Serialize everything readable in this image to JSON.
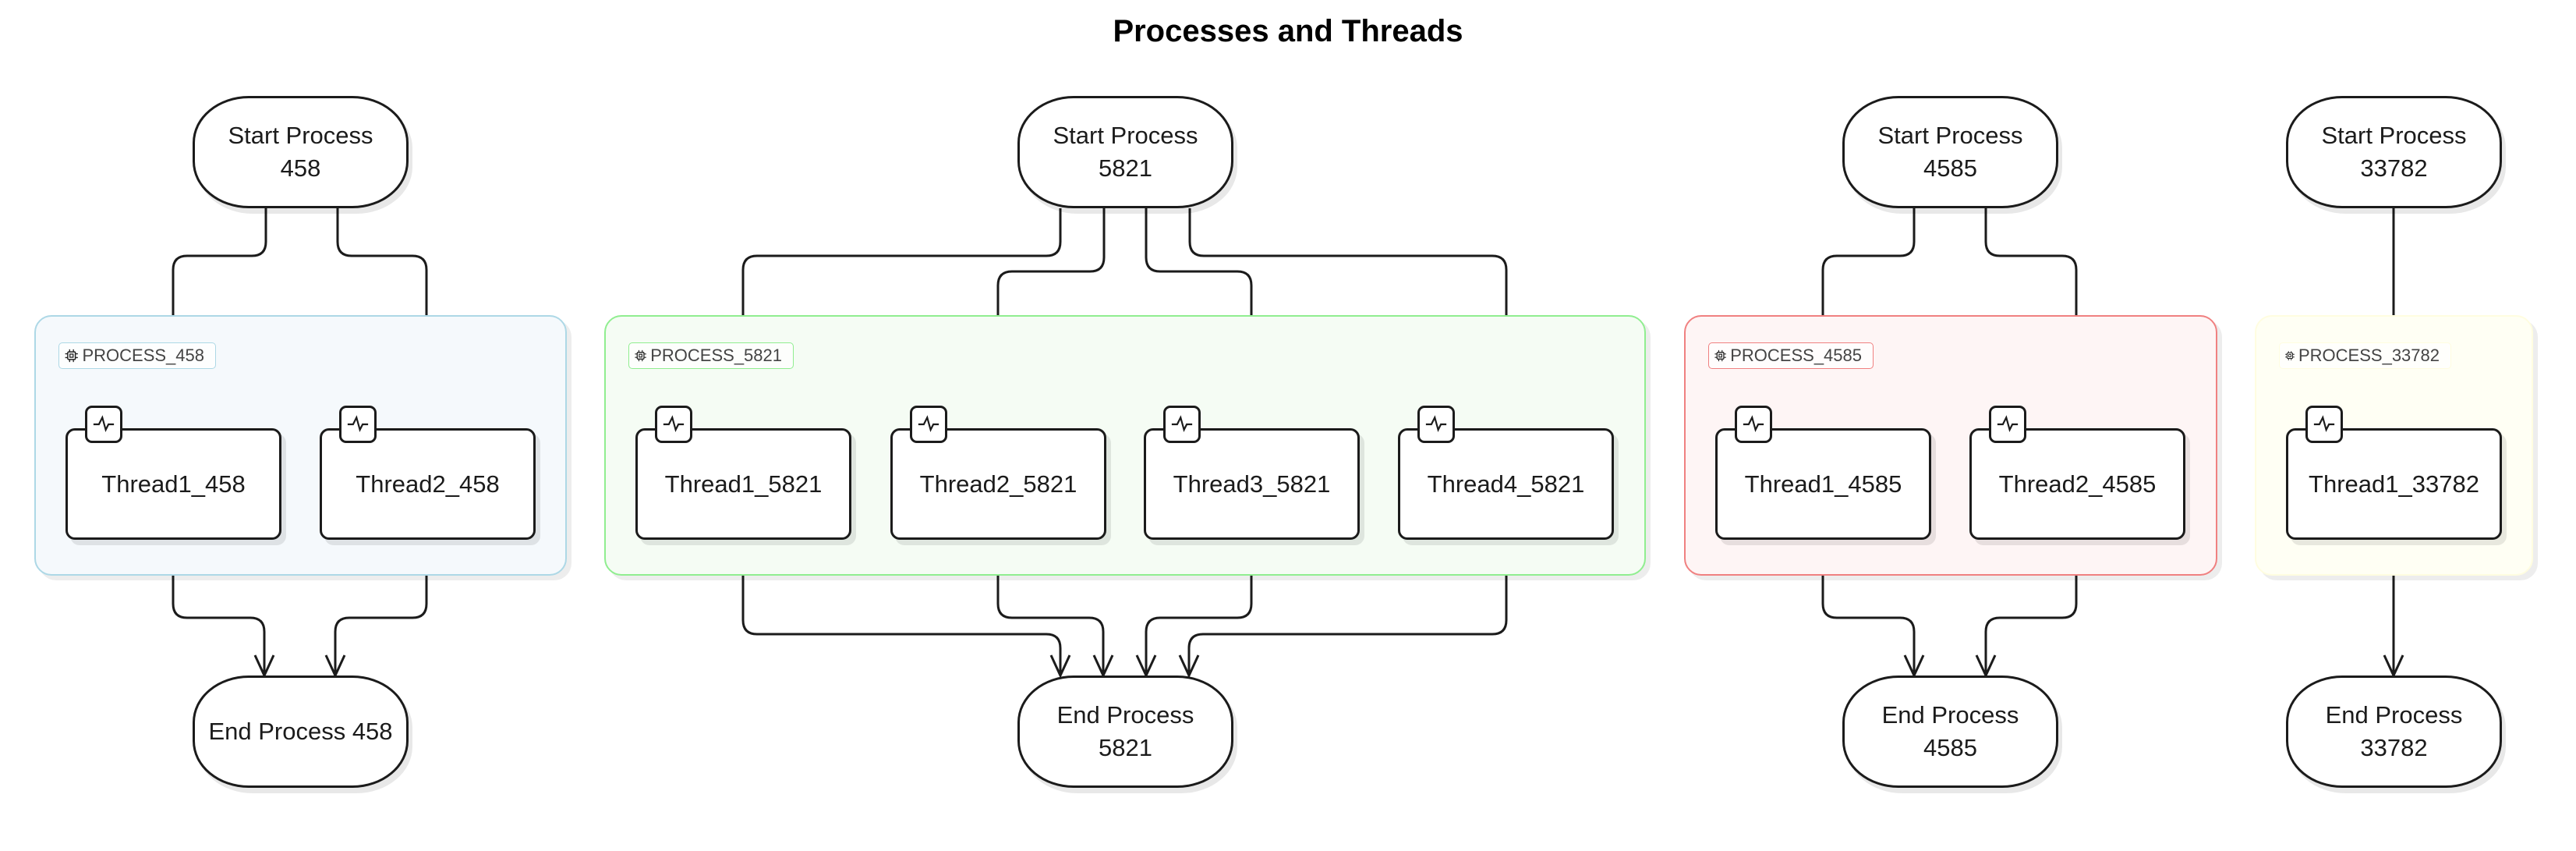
{
  "title": "Processes and Threads",
  "processes": [
    {
      "id": "458",
      "start_label": "Start Process\n458",
      "end_label": "End Process 458",
      "group_label": "PROCESS_458",
      "group_colors": {
        "border": "#add8e6",
        "fill": "#f5f9fc"
      },
      "threads": [
        "Thread1_458",
        "Thread2_458"
      ]
    },
    {
      "id": "5821",
      "start_label": "Start Process\n5821",
      "end_label": "End Process\n5821",
      "group_label": "PROCESS_5821",
      "group_colors": {
        "border": "#90ee90",
        "fill": "#f5fcf4"
      },
      "threads": [
        "Thread1_5821",
        "Thread2_5821",
        "Thread3_5821",
        "Thread4_5821"
      ]
    },
    {
      "id": "4585",
      "start_label": "Start Process\n4585",
      "end_label": "End Process\n4585",
      "group_label": "PROCESS_4585",
      "group_colors": {
        "border": "#f08080",
        "fill": "#fef5f5"
      },
      "threads": [
        "Thread1_4585",
        "Thread2_4585"
      ]
    },
    {
      "id": "33782",
      "start_label": "Start Process\n33782",
      "end_label": "End Process\n33782",
      "group_label": "PROCESS_33782",
      "group_colors": {
        "border": "#fffde0",
        "fill": "#fffff4"
      },
      "threads": [
        "Thread1_33782"
      ]
    }
  ],
  "icons": {
    "group": "cpu-chip-icon",
    "thread": "activity-pulse-icon"
  },
  "edge_color": "#1b1b1b"
}
